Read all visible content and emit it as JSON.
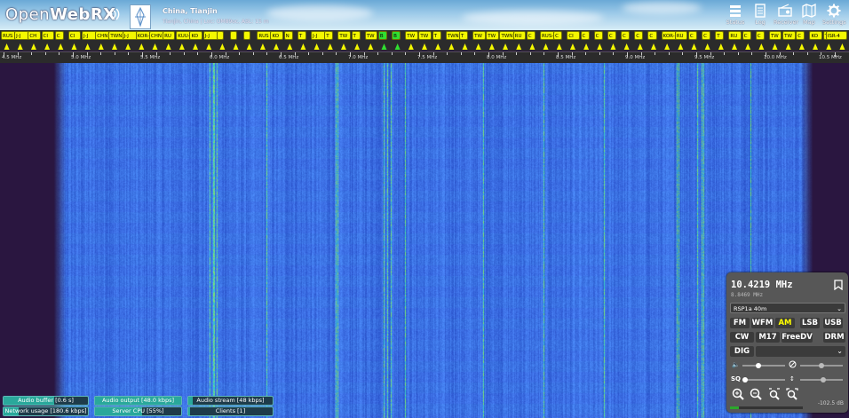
{
  "header": {
    "logo_text_light": "Open",
    "logo_text_bold": "WebRX",
    "receiver_name": "China, Tianjin",
    "receiver_desc": "Tianjin, China | Loc: OM89oc, ASL: 15 m",
    "buttons": [
      {
        "label": "Status",
        "icon": "status-icon"
      },
      {
        "label": "Log",
        "icon": "log-icon"
      },
      {
        "label": "Receiver",
        "icon": "receiver-icon"
      },
      {
        "label": "Map",
        "icon": "map-icon"
      },
      {
        "label": "Settings",
        "icon": "settings-icon"
      }
    ]
  },
  "bookmarks": [
    "RUS",
    "J-J",
    "CH",
    "CI",
    "C",
    "CI",
    "J-J",
    "CHN",
    "TWN",
    "J-J",
    "KOR-S",
    "CHN",
    "RU",
    "KUU-S",
    "KO",
    "J-J",
    "",
    "",
    "",
    "RUS",
    "KO",
    "N",
    "T",
    "J-J",
    "T",
    "TW",
    "T",
    "TW",
    "B",
    "B",
    "TW",
    "TW",
    "T",
    "TWN",
    "T",
    "TW",
    "TW",
    "TWN",
    "RU",
    "C",
    "RUS-S",
    "C",
    "CI",
    "C",
    "C",
    "C",
    "C",
    "C",
    "C",
    "KOR-S",
    "RU",
    "C",
    "C",
    "T",
    "RU",
    "C",
    "C",
    "TW",
    "TW",
    "C",
    "KO",
    "TV",
    "ISR-4"
  ],
  "scale": {
    "labels": [
      "4.5 MHz",
      "5.0 MHz",
      "5.5 MHz",
      "6.0 MHz",
      "6.5 MHz",
      "7.0 MHz",
      "7.5 MHz",
      "8.0 MHz",
      "8.5 MHz",
      "9.0 MHz",
      "9.5 MHz",
      "10.0 MHz",
      "10.5 MHz"
    ]
  },
  "receiver": {
    "frequency": "10.4219 MHz",
    "offset_frequency": "8.8469 MHz",
    "profile": "RSP1a 40m",
    "modes_row1": [
      "FM",
      "WFM",
      "AM",
      "LSB",
      "USB"
    ],
    "modes_row2": [
      "CW",
      "M17",
      "FreeDV",
      "DRM"
    ],
    "dig_label": "DIG",
    "active_mode": "AM",
    "volume_level": 0.35,
    "squelch_level": 0.0,
    "nr_level": 0.5,
    "agc_level": 0.55,
    "smeter_level": 0.12,
    "db_label": "-102.5 dB"
  },
  "status": {
    "audio_buffer": {
      "label": "Audio buffer [0.6 s]",
      "level": 0.6
    },
    "audio_output": {
      "label": "Audio output [48.0 kbps]",
      "level": 1.0
    },
    "audio_stream": {
      "label": "Audio stream [48 kbps]",
      "level": 0.05
    },
    "network_usage": {
      "label": "Network usage [180.6 kbps]",
      "level": 0.18
    },
    "server_cpu": {
      "label": "Server CPU [55%]",
      "level": 0.55
    },
    "clients": {
      "label": "Clients [1]",
      "level": 0.02
    }
  },
  "colors": {
    "bookmark": "#f4f800",
    "bookmark_active": "#30e030",
    "waterfall_base": "#3a5fe0",
    "panel_bg": "#575757",
    "active_mode": "#ffff00",
    "status_fill": "#2aa89b"
  }
}
